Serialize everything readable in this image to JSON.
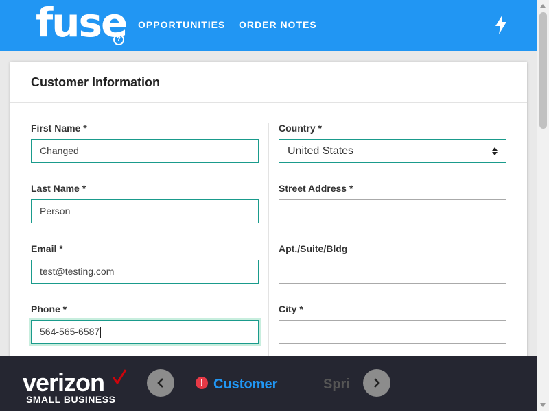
{
  "header": {
    "logo_text": "fuse",
    "help_symbol": "?",
    "nav": [
      {
        "label": "OPPORTUNITIES"
      },
      {
        "label": "ORDER NOTES"
      }
    ],
    "action_icon": "lightning-bolt-icon"
  },
  "card": {
    "title": "Customer Information",
    "left_fields": [
      {
        "label": "First Name *",
        "value": "Changed"
      },
      {
        "label": "Last Name *",
        "value": "Person"
      },
      {
        "label": "Email *",
        "value": "test@testing.com"
      },
      {
        "label": "Phone *",
        "value": "564-565-6587"
      }
    ],
    "right_fields": [
      {
        "label": "Country *",
        "value": "United States"
      },
      {
        "label": "Street Address *",
        "value": ""
      },
      {
        "label": "Apt./Suite/Bldg",
        "value": ""
      },
      {
        "label": "City *",
        "value": ""
      }
    ]
  },
  "footer": {
    "brand": "verizon",
    "sub_brand": "SMALL BUSINESS",
    "alert_symbol": "!",
    "current_step": "Customer",
    "next_step": "Spri"
  },
  "colors": {
    "header_bg": "#2196f3",
    "footer_bg": "#252631",
    "accent_field": "#1a9b8c",
    "verizon_red": "#cd040b",
    "alert_red": "#e63946"
  }
}
